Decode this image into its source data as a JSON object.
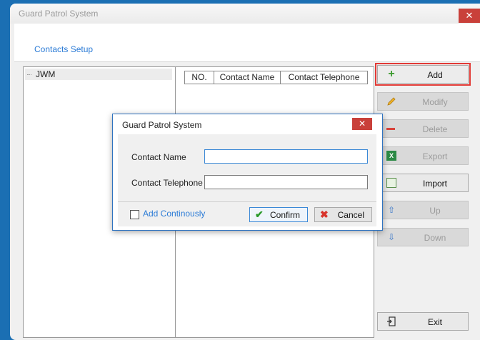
{
  "window": {
    "title": "Guard Patrol System"
  },
  "panel": {
    "header": "Contacts Setup"
  },
  "tree": {
    "root": "JWM"
  },
  "grid": {
    "columns": [
      "NO.",
      "Contact Name",
      "Contact Telephone"
    ]
  },
  "sidebar": {
    "add": "Add",
    "modify": "Modify",
    "delete": "Delete",
    "export": "Export",
    "import": "Import",
    "up": "Up",
    "down": "Down",
    "exit": "Exit"
  },
  "dialog": {
    "title": "Guard Patrol System",
    "contact_name_label": "Contact Name",
    "contact_name_value": "",
    "contact_telephone_label": "Contact Telephone",
    "contact_telephone_value": "",
    "add_continuously_label": "Add Continously",
    "add_continuously_checked": false,
    "confirm_label": "Confirm",
    "cancel_label": "Cancel"
  },
  "icons": {
    "add": "plus-icon",
    "modify": "pencil-icon",
    "delete": "minus-icon",
    "export": "excel-icon",
    "import": "import-icon",
    "up": "arrow-up-icon",
    "down": "arrow-down-icon",
    "exit": "exit-door-icon",
    "confirm": "checkmark-icon",
    "cancel": "x-icon"
  },
  "colors": {
    "accent": "#2b7bd6",
    "close": "#c9403a",
    "highlight": "#e23a36",
    "desktop": "#1b6fb3"
  }
}
